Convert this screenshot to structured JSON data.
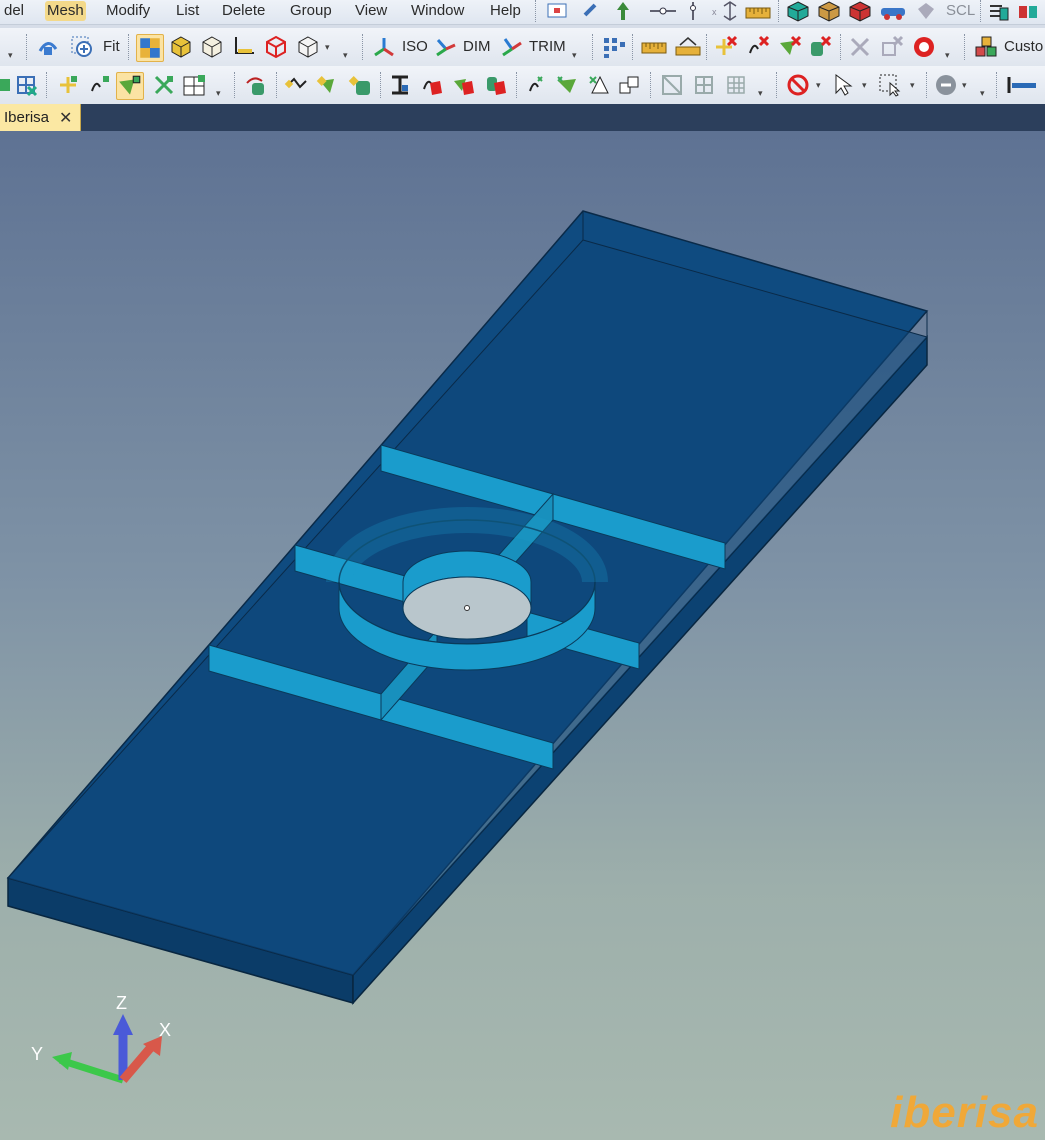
{
  "menubar": {
    "items": [
      "del",
      "Mesh",
      "Modify",
      "List",
      "Delete",
      "Group",
      "View",
      "Window",
      "Help"
    ],
    "scl_label": "SCL"
  },
  "toolbar2": {
    "fit_label": "Fit",
    "iso_label": "ISO",
    "dim_label": "DIM",
    "trim_label": "TRIM",
    "custom_label": "Custo"
  },
  "tabs": [
    {
      "label": "Iberisa",
      "close": "✕"
    }
  ],
  "axes": {
    "z": "Z",
    "y": "Y",
    "x": "X"
  },
  "logo": "iberisa",
  "colors": {
    "model_fill": "#0d4677",
    "model_edge": "#0a2a48",
    "rib_fill": "#1a9ccc",
    "hole_fill": "#b9c6cc",
    "tab_active": "#fbe8a3",
    "logo": "#f0a838"
  }
}
